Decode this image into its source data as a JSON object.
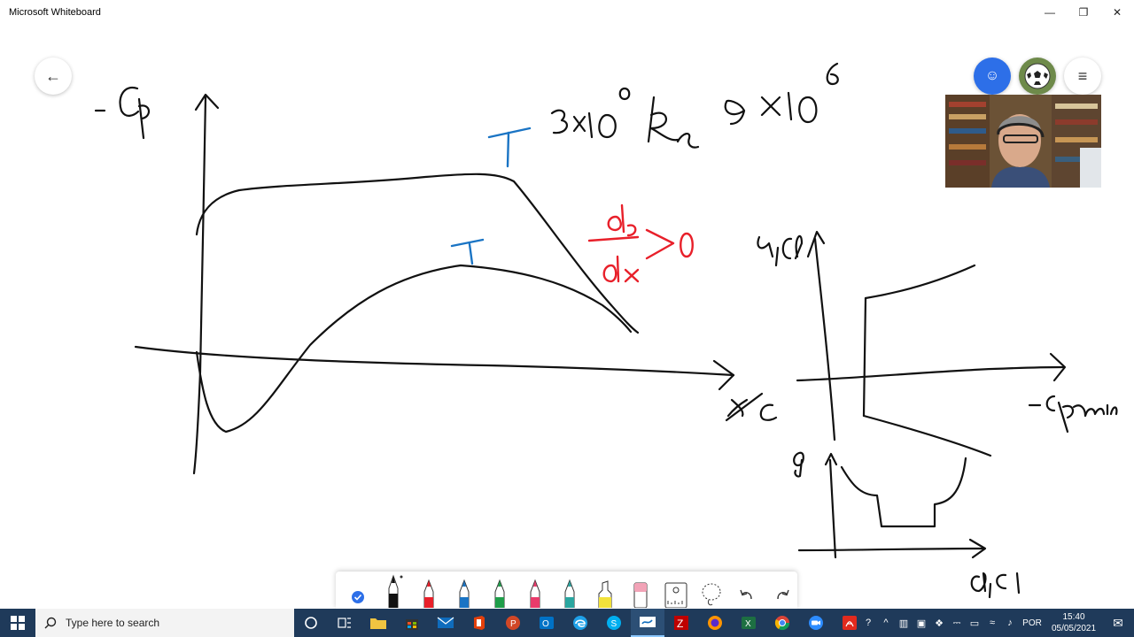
{
  "window": {
    "title": "Microsoft Whiteboard",
    "minimize": "—",
    "restore": "❐",
    "close": "✕"
  },
  "canvas": {
    "back_glyph": "←",
    "menu_glyph": "≡",
    "invite_glyph": "☺"
  },
  "taskbar": {
    "search_placeholder": "Type here to search",
    "language": "POR",
    "time": "15:40",
    "date": "05/05/2021",
    "notification_glyph": "✉"
  },
  "colors": {
    "ink_black": "#111111",
    "ink_blue": "#1a74c4",
    "ink_red": "#e8202a",
    "taskbar": "#1f3a5a",
    "invite_blue": "#2d6fe8"
  }
}
